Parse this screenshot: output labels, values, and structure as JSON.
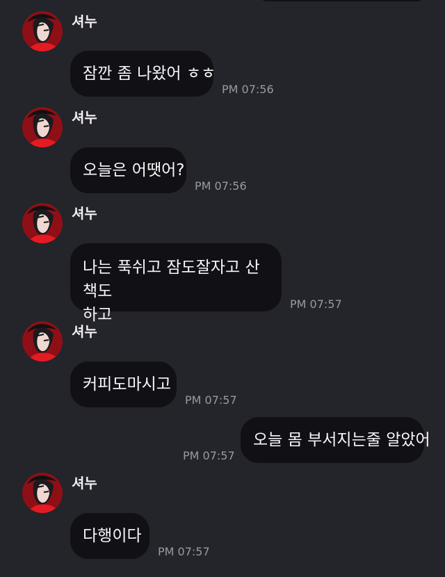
{
  "chat": {
    "messages": [
      {
        "direction": "incoming",
        "sender": "셔누",
        "text": "잠깐 좀 나왔어 ㅎㅎ",
        "time": "PM 07:56"
      },
      {
        "direction": "incoming",
        "sender": "셔누",
        "text": "오늘은 어땟어?",
        "time": "PM 07:56"
      },
      {
        "direction": "incoming",
        "sender": "셔누",
        "text_lines": [
          "나는 푹쉬고 잠도잘자고 산책도",
          "하고"
        ],
        "time": "PM 07:57"
      },
      {
        "direction": "incoming",
        "sender": "셔누",
        "text": "커피도마시고",
        "time": "PM 07:57"
      },
      {
        "direction": "outgoing",
        "text": "오늘 몸 부서지는줄 알았어",
        "time": "PM 07:57"
      },
      {
        "direction": "incoming",
        "sender": "셔누",
        "text": "다행이다",
        "time": "PM 07:57"
      }
    ]
  },
  "icons": {
    "avatar": "sender-avatar-icon"
  },
  "colors": {
    "background": "#24242b",
    "bubble": "#101015",
    "text": "#f8f8fa",
    "time": "#9a9aa2",
    "avatar_red": "#c80f18"
  }
}
